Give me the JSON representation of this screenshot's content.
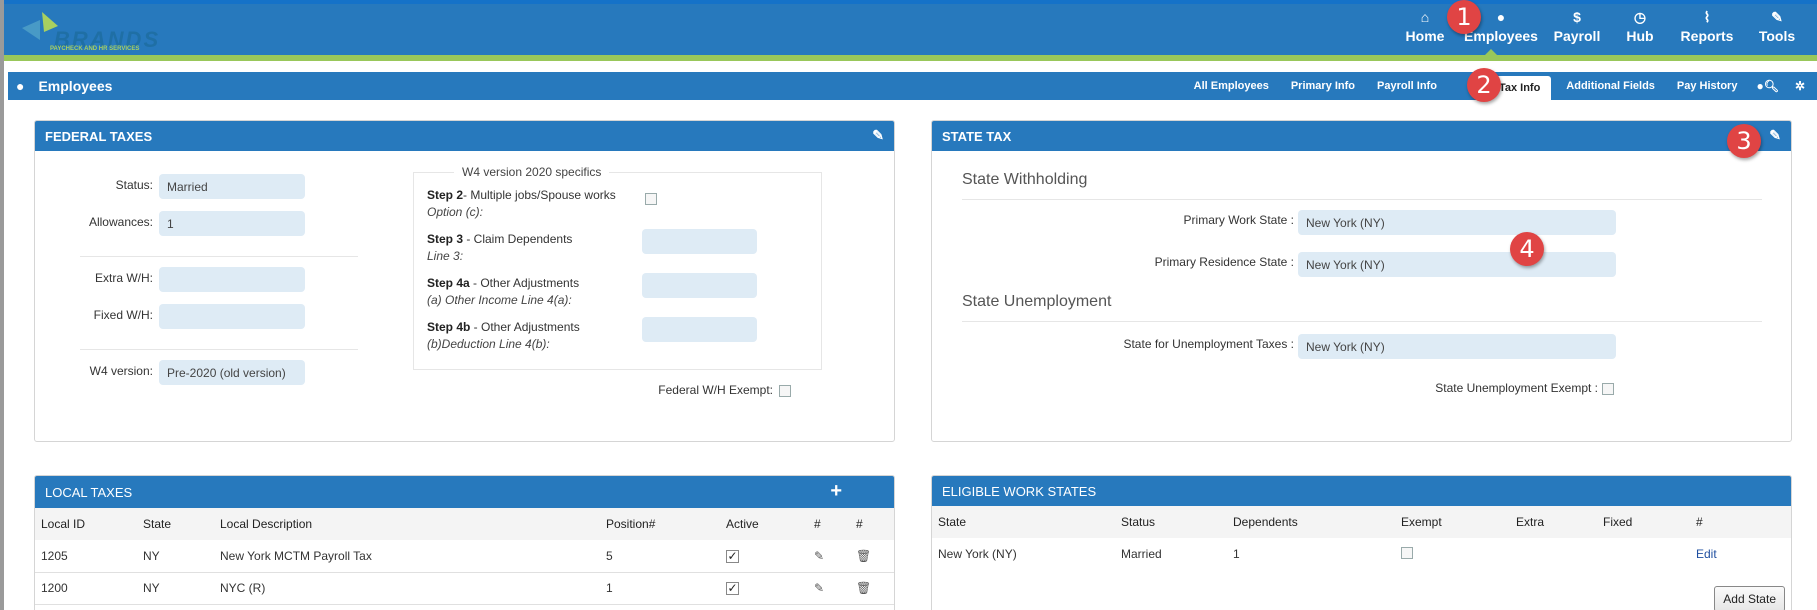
{
  "brand": {
    "name": "BRANDS",
    "tagline": "PAYCHECK AND HR SERVICES"
  },
  "topnav": [
    {
      "icon": "home-icon",
      "glyph": "⌂",
      "label": "Home"
    },
    {
      "icon": "user-icon",
      "glyph": "●",
      "label": "Employees"
    },
    {
      "icon": "dollar-icon",
      "glyph": "$",
      "label": "Payroll"
    },
    {
      "icon": "clock-icon",
      "glyph": "◷",
      "label": "Hub"
    },
    {
      "icon": "paperclip-icon",
      "glyph": "⌇",
      "label": "Reports"
    },
    {
      "icon": "wrench-icon",
      "glyph": "✎",
      "label": "Tools"
    }
  ],
  "subbar": {
    "title": "Employees",
    "tabs": [
      "All Employees",
      "Primary Info",
      "Payroll Info",
      "Tax Info",
      "Additional Fields",
      "Pay History"
    ],
    "active_tab": "Tax Info"
  },
  "federal": {
    "title": "FEDERAL TAXES",
    "status_label": "Status:",
    "status_value": "Married",
    "allowances_label": "Allowances:",
    "allowances_value": "1",
    "extra_label": "Extra W/H:",
    "extra_value": "",
    "fixed_label": "Fixed W/H:",
    "fixed_value": "",
    "w4_label": "W4 version:",
    "w4_value": "Pre-2020 (old version)",
    "w4_2020": {
      "legend": "W4 version 2020 specifics",
      "step2_bold": "Step 2",
      "step2_text": "- Multiple jobs/Spouse works",
      "step2_sub": "Option (c):",
      "step3_bold": "Step 3",
      "step3_text": " - Claim Dependents",
      "step3_sub": "Line 3:",
      "step4a_bold": "Step 4a",
      "step4a_text": " - Other Adjustments",
      "step4a_sub": "(a) Other Income Line 4(a):",
      "step4b_bold": "Step 4b",
      "step4b_text": " - Other Adjustments",
      "step4b_sub": "(b)Deduction Line 4(b):"
    },
    "exempt_label": "Federal W/H Exempt:"
  },
  "state": {
    "title": "STATE TAX",
    "withholding_title": "State Withholding",
    "work_state_label": "Primary Work State :",
    "work_state_value": "New York (NY)",
    "residence_state_label": "Primary Residence State :",
    "residence_state_value": "New York (NY)",
    "unemployment_title": "State Unemployment",
    "unemp_state_label": "State for Unemployment Taxes :",
    "unemp_state_value": "New York (NY)",
    "unemp_exempt_label": "State Unemployment Exempt :"
  },
  "local": {
    "title": "LOCAL TAXES",
    "columns": [
      "Local ID",
      "State",
      "Local Description",
      "Position#",
      "Active",
      "#",
      "#"
    ],
    "rows": [
      {
        "id": "1205",
        "state": "NY",
        "desc": "New York MCTM Payroll Tax",
        "position": "5",
        "active": true
      },
      {
        "id": "1200",
        "state": "NY",
        "desc": "NYC (R)",
        "position": "1",
        "active": true
      }
    ]
  },
  "eligible": {
    "title": "ELIGIBLE WORK STATES",
    "columns": [
      "State",
      "Status",
      "Dependents",
      "Exempt",
      "Extra",
      "Fixed",
      "#"
    ],
    "rows": [
      {
        "state": "New York (NY)",
        "status": "Married",
        "dependents": "1",
        "exempt": false,
        "extra": "",
        "fixed": "",
        "action": "Edit"
      }
    ],
    "add_label": "Add State"
  },
  "callouts": [
    "1",
    "2",
    "3",
    "4"
  ],
  "colors": {
    "primary": "#2779bd",
    "accent_green": "#99c75a",
    "field_bg": "#deebf5",
    "badge": "#e04444"
  }
}
